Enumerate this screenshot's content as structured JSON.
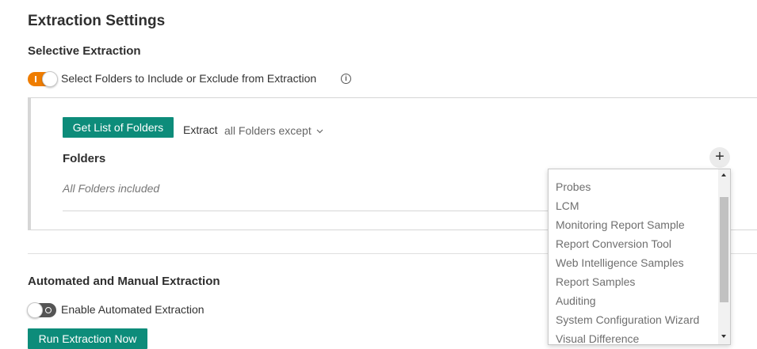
{
  "page_title": "Extraction Settings",
  "selective": {
    "heading": "Selective Extraction",
    "toggle_label": "Select Folders to Include or Exclude from Extraction",
    "toggle_on": true,
    "info_icon": "i",
    "get_list_button": "Get List of Folders",
    "extract_label": "Extract",
    "extract_mode": "all Folders except",
    "folders_heading": "Folders",
    "folders_empty": "All Folders included",
    "add_button": "+"
  },
  "folder_dropdown": {
    "items": [
      "Probes",
      "LCM",
      "Monitoring Report Sample",
      "Report Conversion Tool",
      "Web Intelligence Samples",
      "Report Samples",
      "Auditing",
      "System Configuration Wizard",
      "Visual Difference"
    ]
  },
  "automated": {
    "heading": "Automated and Manual Extraction",
    "toggle_label": "Enable Automated Extraction",
    "toggle_on": false,
    "run_button": "Run Extraction Now"
  },
  "colors": {
    "accent_orange": "#ef7d00",
    "button_green": "#0d8c7a",
    "toggle_off": "#555555"
  }
}
